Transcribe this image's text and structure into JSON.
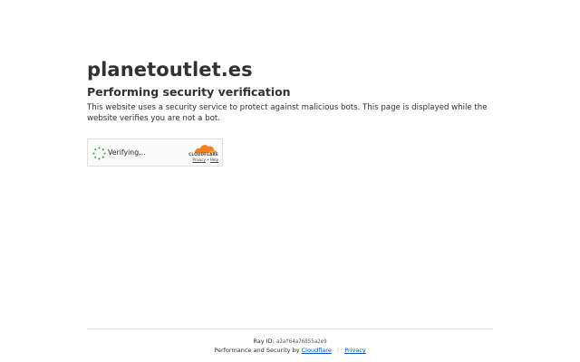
{
  "page": {
    "site_title": "planetoutlet.es",
    "heading": "Performing security verification",
    "description": "This website uses a security service to protect against malicious bots. This page is displayed while the website verifies you are not a bot."
  },
  "widget": {
    "status_text": "Verifying...",
    "brand": "CLOUDFLARE",
    "privacy_link": "Privacy",
    "separator": "•",
    "help_link": "Help",
    "logo_color": "#f38020",
    "spinner_color": "#2a9d3a"
  },
  "footer": {
    "ray_label": "Ray ID:",
    "ray_id": "a2af64a76855a2e9",
    "perf_text": "Performance and Security by",
    "cloudflare_link": "Cloudflare",
    "separator": "|",
    "privacy_link": "Privacy"
  }
}
